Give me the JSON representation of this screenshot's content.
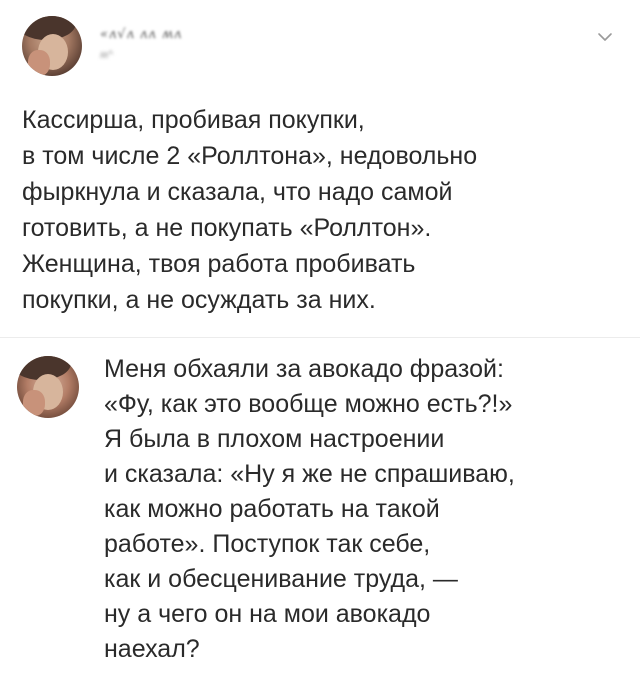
{
  "post": {
    "username": "«ʌ√ʌ ʌʌ ʍʌ",
    "handle": "ʍ^ ",
    "menu_icon": "chevron-down-icon",
    "lines": [
      "Кассирша, пробивая покупки,",
      "в том числе 2 «Роллтона», недовольно",
      "фыркнула и сказала, что надо самой",
      "готовить, а не покупать «Роллтон».",
      "Женщина, твоя работа пробивать",
      "покупки, а не осуждать за них."
    ]
  },
  "reply": {
    "lines": [
      "Меня обхаяли за авокадо фразой:",
      "«Фу, как это вообще можно есть?!»",
      "Я была в плохом настроении",
      "и сказала: «Ну я же не спрашиваю,",
      "как можно работать на такой",
      "работе». Поступок так себе,",
      "как и обесценивание труда, —",
      "ну а чего он на мои авокадо",
      "наехал?"
    ]
  },
  "colors": {
    "text": "#2a2a2a",
    "divider": "#ececec",
    "chevron": "#9a9a9a"
  }
}
